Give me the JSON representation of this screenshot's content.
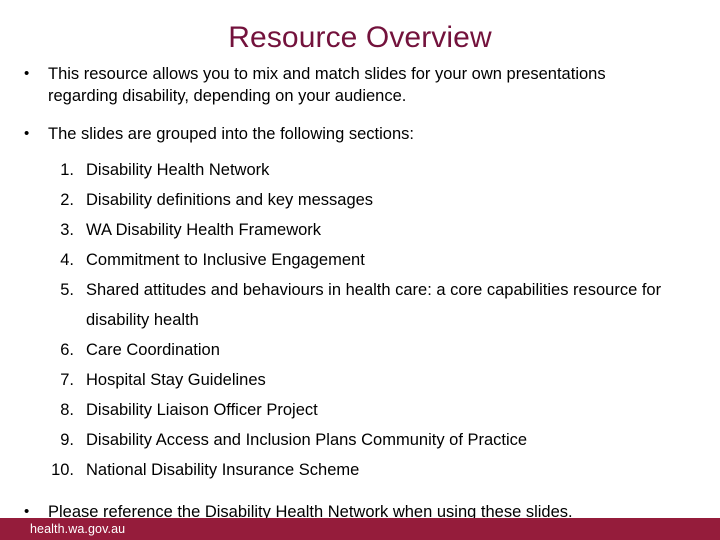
{
  "slide": {
    "title": "Resource Overview",
    "title_color": "#73123c",
    "background_color": "#ffffff",
    "body_text_color": "#000000",
    "bullet_glyph": "•"
  },
  "intro_bullets": [
    {
      "text": "This resource allows you to mix and match slides for your own presentations regarding disability, depending on your audience."
    },
    {
      "text": "The slides are grouped into the following sections:"
    }
  ],
  "sections_list": [
    {
      "number": "1.",
      "label": "Disability Health Network"
    },
    {
      "number": "2.",
      "label": "Disability definitions and key messages"
    },
    {
      "number": "3.",
      "label": "WA Disability Health Framework"
    },
    {
      "number": "4.",
      "label": "Commitment to Inclusive Engagement"
    },
    {
      "number": "5.",
      "label": "Shared attitudes and behaviours in health care: a core capabilities resource for disability health"
    },
    {
      "number": "6.",
      "label": "Care Coordination"
    },
    {
      "number": "7.",
      "label": "Hospital Stay Guidelines"
    },
    {
      "number": "8.",
      "label": "Disability Liaison Officer Project"
    },
    {
      "number": "9.",
      "label": "Disability Access and Inclusion Plans Community of Practice"
    },
    {
      "number": "10.",
      "label": "National Disability Insurance Scheme"
    }
  ],
  "closing_bullet": {
    "text": "Please reference the Disability Health Network when using these slides."
  },
  "footer": {
    "url": "health.wa.gov.au",
    "bar_color": "#951c3b",
    "text_color": "#ffffff"
  }
}
